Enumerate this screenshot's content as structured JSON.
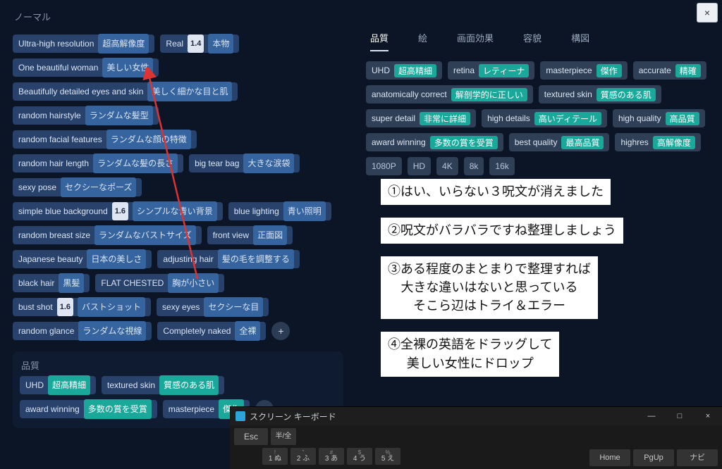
{
  "left": {
    "section1_title": "ノーマル",
    "tags1": [
      {
        "en": "Ultra-high resolution",
        "num": null,
        "jp": "超高解像度"
      },
      {
        "en": "Real",
        "num": "1.4",
        "jp": "本物"
      },
      {
        "en": "One beautiful woman",
        "num": null,
        "jp": "美しい女性"
      },
      {
        "en": "Beautifully detailed eyes and skin",
        "num": null,
        "jp": "美しく細かな目と肌"
      },
      {
        "en": "random hairstyle",
        "num": null,
        "jp": "ランダムな髪型"
      },
      {
        "en": "random facial features",
        "num": null,
        "jp": "ランダムな顔の特徴"
      },
      {
        "en": "random hair length",
        "num": null,
        "jp": "ランダムな髪の長さ"
      },
      {
        "en": "big tear bag",
        "num": null,
        "jp": "大きな涙袋"
      },
      {
        "en": "sexy pose",
        "num": null,
        "jp": "セクシーなポーズ"
      },
      {
        "en": "simple blue background",
        "num": "1.6",
        "jp": "シンプルな青い背景"
      },
      {
        "en": "blue lighting",
        "num": null,
        "jp": "青い照明"
      },
      {
        "en": "random breast size",
        "num": null,
        "jp": "ランダムなバストサイズ"
      },
      {
        "en": "front view",
        "num": null,
        "jp": "正面図"
      },
      {
        "en": "Japanese beauty",
        "num": null,
        "jp": "日本の美しさ"
      },
      {
        "en": "adjusting hair",
        "num": null,
        "jp": "髪の毛を調整する"
      },
      {
        "en": "black hair",
        "num": null,
        "jp": "黒髪"
      },
      {
        "en": "FLAT CHESTED",
        "num": null,
        "jp": "胸が小さい"
      },
      {
        "en": "bust shot",
        "num": "1.6",
        "jp": "バストショット"
      },
      {
        "en": "sexy eyes",
        "num": null,
        "jp": "セクシーな目"
      },
      {
        "en": "random glance",
        "num": null,
        "jp": "ランダムな視線"
      },
      {
        "en": "Completely naked",
        "num": null,
        "jp": "全裸"
      }
    ],
    "plus": "+",
    "section2_title": "品質",
    "tags2": [
      {
        "en": "UHD",
        "jp": "超高精細"
      },
      {
        "en": "textured skin",
        "jp": "質感のある肌"
      },
      {
        "en": "award winning",
        "jp": "多数の賞を受賞"
      },
      {
        "en": "masterpiece",
        "jp": "傑作"
      }
    ],
    "plus2": "+"
  },
  "right": {
    "close": "×",
    "tabs": [
      "品質",
      "絵",
      "画面効果",
      "容貌",
      "構図"
    ],
    "rtags": [
      {
        "en": "UHD",
        "jp": "超高精細"
      },
      {
        "en": "retina",
        "jp": "レティーナ"
      },
      {
        "en": "masterpiece",
        "jp": "傑作"
      },
      {
        "en": "accurate",
        "jp": "精確"
      },
      {
        "en": "anatomically correct",
        "jp": "解剖学的に正しい"
      },
      {
        "en": "textured skin",
        "jp": "質感のある肌"
      },
      {
        "en": "super detail",
        "jp": "非常に詳細"
      },
      {
        "en": "high details",
        "jp": "高いディテール"
      },
      {
        "en": "high quality",
        "jp": "高品質"
      },
      {
        "en": "award winning",
        "jp": "多数の賞を受賞"
      },
      {
        "en": "best quality",
        "jp": "最高品質"
      },
      {
        "en": "highres",
        "jp": "高解像度"
      }
    ],
    "plain": [
      "1080P",
      "HD",
      "4K",
      "8k",
      "16k"
    ]
  },
  "notes": [
    "①はい、いらない３呪文が消えました",
    "②呪文がバラバラですね整理しましょう",
    "③ある程度のまとまりで整理すれば\n大きな違いはないと思っている\nそこら辺はトライ＆エラー",
    "④全裸の英語をドラッグして\n美しい女性にドロップ"
  ],
  "osk": {
    "title": "スクリーン キーボード",
    "row1": [
      "Esc",
      "半/全"
    ],
    "row2_top": [
      "!",
      "\"",
      "#",
      "$",
      "%"
    ],
    "row2_bot": [
      "1 ぬ",
      "2 ふ",
      "3 あ",
      "4 う",
      "5 え"
    ],
    "right_keys": [
      "Home",
      "PgUp",
      "ナビ"
    ]
  },
  "winctrl": {
    "min": "—",
    "max": "□",
    "close": "×"
  }
}
